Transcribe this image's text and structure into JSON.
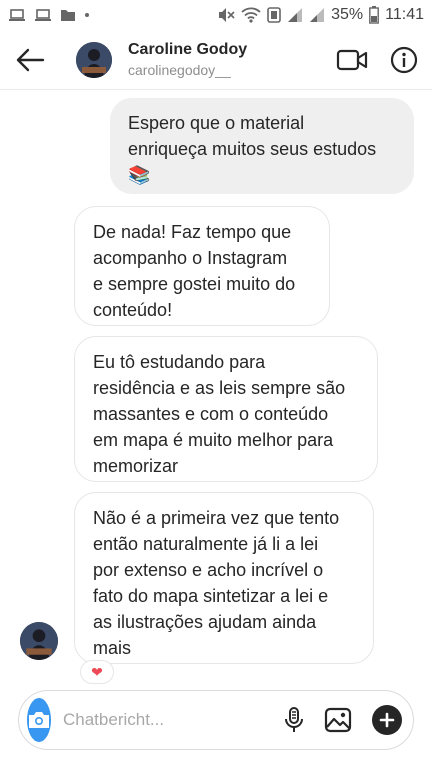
{
  "status_bar": {
    "battery": "35%",
    "time": "11:41",
    "left_icons": [
      "laptop-icon",
      "laptop-icon",
      "folder-icon",
      "dot-icon"
    ],
    "right_icons": [
      "mute-icon",
      "wifi-icon",
      "nfc-icon",
      "signal-icon",
      "signal-icon",
      "battery-icon"
    ]
  },
  "header": {
    "name": "Caroline Godoy",
    "username": "carolinegodoy__",
    "back_icon": "arrow-left-icon",
    "video_icon": "video-camera-icon",
    "info_icon": "info-icon"
  },
  "messages": [
    {
      "type": "sent",
      "lines": [
        "Espero que o material",
        "enriqueça muitos seus estudos",
        "📚"
      ]
    },
    {
      "type": "received",
      "lines": [
        "De nada! Faz tempo que",
        "acompanho o Instagram",
        "e sempre gostei muito do",
        "conteúdo!"
      ]
    },
    {
      "type": "received",
      "lines": [
        "Eu tô estudando para",
        "residência e as leis sempre são",
        "massantes e com o conteúdo",
        "em mapa é muito melhor para",
        "memorizar"
      ]
    },
    {
      "type": "received",
      "lines": [
        "Não é a primeira vez que tento",
        "então naturalmente já li a lei",
        "por extenso e acho incrível o",
        "fato do mapa sintetizar a lei e",
        "as ilustrações ajudam ainda",
        "mais"
      ],
      "reaction": "❤"
    }
  ],
  "composer": {
    "placeholder": "Chatbericht...",
    "camera_icon": "camera-icon",
    "mic_icon": "microphone-icon",
    "gallery_icon": "image-icon",
    "plus_icon": "plus-icon"
  },
  "colors": {
    "accent": "#3897f0",
    "sent_bubble": "#efefef",
    "heart": "#ed4956"
  }
}
